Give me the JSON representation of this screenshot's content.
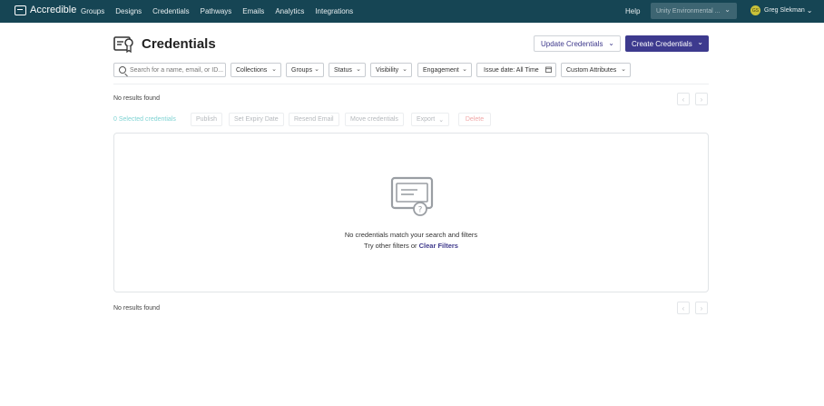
{
  "nav": {
    "brand": "Accredible",
    "items": [
      "Groups",
      "Designs",
      "Credentials",
      "Pathways",
      "Emails",
      "Analytics",
      "Integrations"
    ],
    "help": "Help",
    "org_select": "Unity Environmental ...",
    "user_initials": "GS",
    "user_name": "Greg Slekman"
  },
  "header": {
    "title": "Credentials",
    "update_button": "Update Credentials",
    "create_button": "Create Credentials"
  },
  "filters": {
    "search_placeholder": "Search for a name, email, or ID...",
    "collections": "Collections",
    "groups": "Groups",
    "status": "Status",
    "visibility": "Visibility",
    "engagement": "Engagement",
    "issue_date": "Issue date: All Time",
    "custom_attributes": "Custom Attributes"
  },
  "results_top": "No results found",
  "results_bottom": "No results found",
  "actions": {
    "selected": "0 Selected credentials",
    "publish": "Publish",
    "set_expiry": "Set Expiry Date",
    "resend": "Resend Email",
    "move": "Move credentials",
    "export": "Export",
    "delete": "Delete"
  },
  "empty_state": {
    "message": "No credentials match your search and filters",
    "sub_prefix": "Try other filters or",
    "clear_link": "Clear Filters"
  },
  "colors": {
    "nav_bg": "#164554",
    "primary": "#3d3a8e",
    "selected_text": "#7fd3d3",
    "delete_text": "#f0a8a8"
  }
}
